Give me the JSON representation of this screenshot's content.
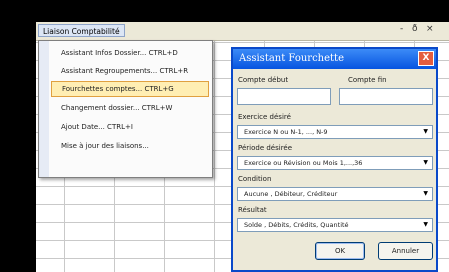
{
  "menubar": {
    "menu_title": "Liaison Comptabilité",
    "minimize": "-",
    "restore": "ð",
    "close": "×"
  },
  "menu": {
    "items": [
      {
        "label": "Assistant Infos Dossier... CTRL+D"
      },
      {
        "label": "Assistant Regroupements... CTRL+R"
      },
      {
        "label": "Fourchettes comptes... CTRL+G"
      },
      {
        "label": "Changement dossier... CTRL+W"
      },
      {
        "label": "Ajout Date... CTRL+I"
      },
      {
        "label": "Mise à jour des liaisons..."
      }
    ],
    "highlighted_index": 2
  },
  "dialog": {
    "title": "Assistant Fourchette",
    "close_glyph": "X",
    "compte_debut_label": "Compte début",
    "compte_fin_label": "Compte fin",
    "compte_debut_value": "",
    "compte_fin_value": "",
    "exercice_label": "Exercice désiré",
    "exercice_value": "Exercice N ou N-1, ..., N-9",
    "periode_label": "Période désirée",
    "periode_value": "Exercice ou Révision ou Mois 1,...,36",
    "condition_label": "Condition",
    "condition_value": "Aucune , Débiteur, Créditeur",
    "resultat_label": "Résultat",
    "resultat_value": "Solde , Débits, Crédits, Quantité",
    "ok_label": "OK",
    "cancel_label": "Annuler"
  },
  "colors": {
    "title_bar": "#0654e0",
    "menu_highlight": "#ffeeb3",
    "dialog_bg": "#ece9d8"
  }
}
